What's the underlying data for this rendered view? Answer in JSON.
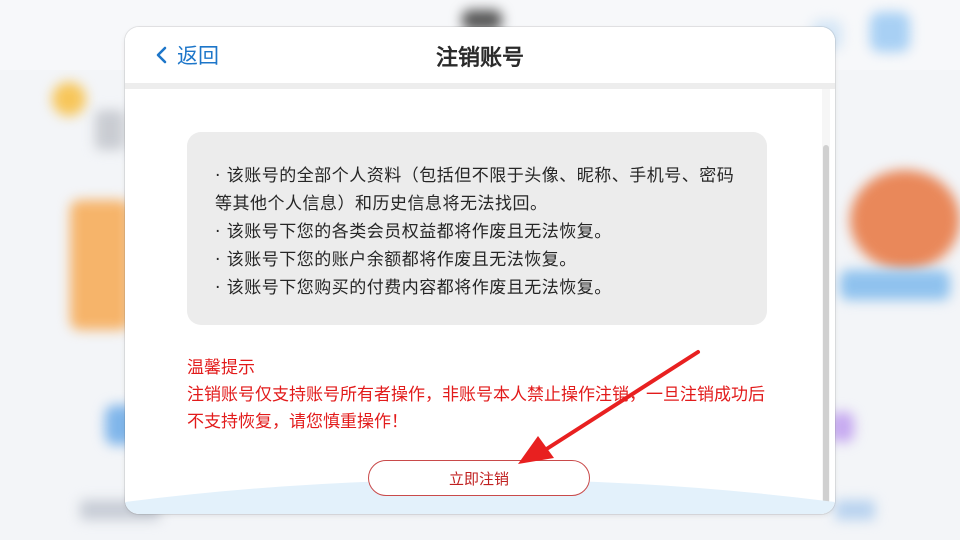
{
  "header": {
    "back_label": "返回",
    "title": "注销账号"
  },
  "info": {
    "items": [
      "· 该账号的全部个人资料（包括但不限于头像、昵称、手机号、密码等其他个人信息）和历史信息将无法找回。",
      "· 该账号下您的各类会员权益都将作废且无法恢复。",
      "· 该账号下您的账户余额都将作废且无法恢复。",
      "· 该账号下您购买的付费内容都将作废且无法恢复。"
    ]
  },
  "warning": {
    "title": "温馨提示",
    "text": "注销账号仅支持账号所有者操作，非账号本人禁止操作注销，一旦注销成功后不支持恢复，请您慎重操作！"
  },
  "actions": {
    "confirm_label": "立即注销"
  },
  "colors": {
    "accent_blue": "#1d76c9",
    "warning_red": "#e21b1b",
    "arrow_red": "#e82020"
  }
}
